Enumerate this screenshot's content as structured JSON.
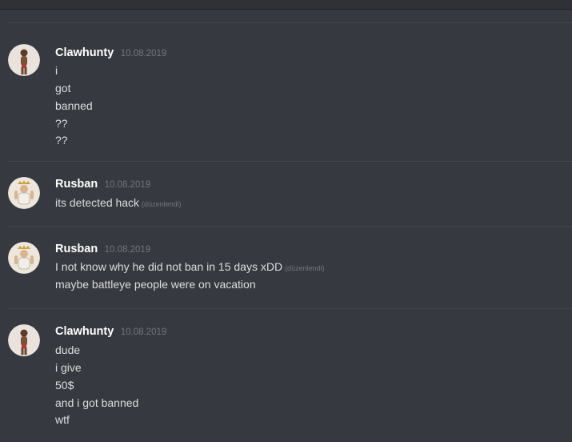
{
  "messages": [
    {
      "author": "Clawhunty",
      "timestamp": "10.08.2019",
      "avatar_icon": "avatar-clawhunty-icon",
      "lines": [
        {
          "text": "i",
          "edited": ""
        },
        {
          "text": "got",
          "edited": ""
        },
        {
          "text": "banned",
          "edited": ""
        },
        {
          "text": "??",
          "edited": ""
        },
        {
          "text": "??",
          "edited": ""
        }
      ]
    },
    {
      "author": "Rusban",
      "timestamp": "10.08.2019",
      "avatar_icon": "avatar-rusban-icon",
      "lines": [
        {
          "text": "its detected hack",
          "edited": "(düzenlendi)"
        }
      ]
    },
    {
      "author": "Rusban",
      "timestamp": "10.08.2019",
      "avatar_icon": "avatar-rusban-icon",
      "lines": [
        {
          "text": "I not know why he did not ban in 15 days xDD",
          "edited": "(düzenlendi)"
        },
        {
          "text": "maybe battleye people were on vacation",
          "edited": ""
        }
      ]
    },
    {
      "author": "Clawhunty",
      "timestamp": "10.08.2019",
      "avatar_icon": "avatar-clawhunty-icon",
      "lines": [
        {
          "text": "dude",
          "edited": ""
        },
        {
          "text": "i give",
          "edited": ""
        },
        {
          "text": "50$",
          "edited": ""
        },
        {
          "text": "and i got banned",
          "edited": ""
        },
        {
          "text": "wtf",
          "edited": ""
        }
      ]
    }
  ],
  "colors": {
    "background": "#36393f",
    "username": "#ffffff",
    "message_text": "#dcddde",
    "timestamp": "#72767d"
  }
}
